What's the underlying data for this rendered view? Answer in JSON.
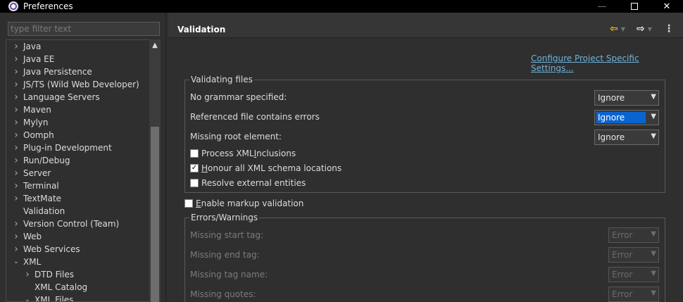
{
  "window": {
    "title": "Preferences"
  },
  "filter": {
    "placeholder": "type filter text"
  },
  "tree": {
    "items": [
      {
        "label": "Java",
        "expandable": true,
        "child": false
      },
      {
        "label": "Java EE",
        "expandable": true,
        "child": false
      },
      {
        "label": "Java Persistence",
        "expandable": true,
        "child": false
      },
      {
        "label": "JS/TS (Wild Web Developer)",
        "expandable": true,
        "child": false
      },
      {
        "label": "Language Servers",
        "expandable": true,
        "child": false
      },
      {
        "label": "Maven",
        "expandable": true,
        "child": false
      },
      {
        "label": "Mylyn",
        "expandable": true,
        "child": false
      },
      {
        "label": "Oomph",
        "expandable": true,
        "child": false
      },
      {
        "label": "Plug-in Development",
        "expandable": true,
        "child": false
      },
      {
        "label": "Run/Debug",
        "expandable": true,
        "child": false
      },
      {
        "label": "Server",
        "expandable": true,
        "child": false
      },
      {
        "label": "Terminal",
        "expandable": true,
        "child": false
      },
      {
        "label": "TextMate",
        "expandable": true,
        "child": false
      },
      {
        "label": "Validation",
        "expandable": false,
        "child": false
      },
      {
        "label": "Version Control (Team)",
        "expandable": true,
        "child": false
      },
      {
        "label": "Web",
        "expandable": true,
        "child": false
      },
      {
        "label": "Web Services",
        "expandable": true,
        "child": false
      },
      {
        "label": "XML",
        "expandable": true,
        "expanded": true,
        "child": false
      },
      {
        "label": "DTD Files",
        "expandable": true,
        "child": true
      },
      {
        "label": "XML Catalog",
        "expandable": false,
        "child": true
      },
      {
        "label": "XML Files",
        "expandable": true,
        "expanded": true,
        "child": true
      }
    ]
  },
  "page": {
    "title": "Validation",
    "config_link": "Configure Project Specific Settings...",
    "validating": {
      "legend": "Validating files",
      "rows": [
        {
          "label": "No grammar specified:",
          "value": "Ignore"
        },
        {
          "label": "Referenced file contains errors",
          "value": "Ignore"
        },
        {
          "label": "Missing root element:",
          "value": "Ignore"
        }
      ],
      "checks": [
        {
          "pre": "Process XML ",
          "u": "I",
          "post": "nclusions",
          "checked": false
        },
        {
          "pre": "",
          "u": "H",
          "post": "onour all XML schema locations",
          "checked": true
        },
        {
          "pre": "Resolve external entities",
          "u": "",
          "post": "",
          "checked": false
        }
      ]
    },
    "markup": {
      "pre": "",
      "u": "E",
      "post": "nable markup validation",
      "checked": false
    },
    "errors": {
      "legend": "Errors/Warnings",
      "rows": [
        {
          "label": "Missing start tag:",
          "value": "Error"
        },
        {
          "label": "Missing end tag:",
          "value": "Error"
        },
        {
          "label": "Missing tag name:",
          "value": "Error"
        },
        {
          "label": "Missing quotes:",
          "value": "Error"
        }
      ]
    }
  },
  "colors": {
    "accent": "#0a64d0",
    "link": "#6fb3d8",
    "back_arrow": "#f0c020"
  }
}
